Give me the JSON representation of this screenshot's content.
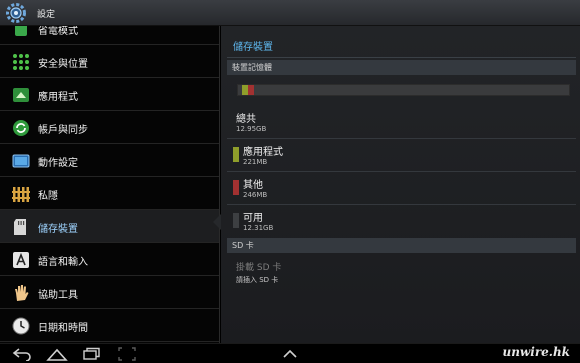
{
  "app": {
    "title": "設定",
    "icon": "gear-icon"
  },
  "sidebar": {
    "items": [
      {
        "label": "省電模式",
        "icon": "power-saving-icon"
      },
      {
        "label": "安全與位置",
        "icon": "lock-pattern-icon"
      },
      {
        "label": "應用程式",
        "icon": "applications-icon"
      },
      {
        "label": "帳戶與同步",
        "icon": "sync-icon"
      },
      {
        "label": "動作設定",
        "icon": "motion-icon"
      },
      {
        "label": "私隱",
        "icon": "privacy-icon"
      },
      {
        "label": "儲存裝置",
        "icon": "sd-card-icon",
        "selected": true
      },
      {
        "label": "語言和輸入",
        "icon": "language-input-icon"
      },
      {
        "label": "協助工具",
        "icon": "accessibility-hand-icon"
      },
      {
        "label": "日期和時間",
        "icon": "clock-icon"
      }
    ]
  },
  "pane": {
    "title": "儲存裝置",
    "device_memory": {
      "header": "裝置記憶體",
      "usage": [
        {
          "name": "應用程式",
          "fraction": 0.017,
          "color": "#8f9e2b"
        },
        {
          "name": "其他",
          "fraction": 0.019,
          "color": "#a23131"
        }
      ],
      "total": {
        "label": "總共",
        "value": "12.95GB"
      },
      "rows": [
        {
          "label": "應用程式",
          "value": "221MB",
          "color": "#8f9e2b"
        },
        {
          "label": "其他",
          "value": "246MB",
          "color": "#a23131"
        },
        {
          "label": "可用",
          "value": "12.31GB",
          "color": "#3d3f42"
        }
      ]
    },
    "sd_card": {
      "header": "SD 卡",
      "mount_label": "掛載 SD 卡",
      "mount_hint": "請插入 SD 卡"
    }
  },
  "system_bar": {
    "buttons": [
      "back-icon",
      "home-icon",
      "recent-apps-icon",
      "screenshot-icon",
      "expand-up-icon"
    ],
    "watermark": "unwire.hk"
  },
  "colors": {
    "accent": "#5fb8ee",
    "apps": "#8f9e2b",
    "misc": "#a23131",
    "free": "#3d3f42"
  }
}
